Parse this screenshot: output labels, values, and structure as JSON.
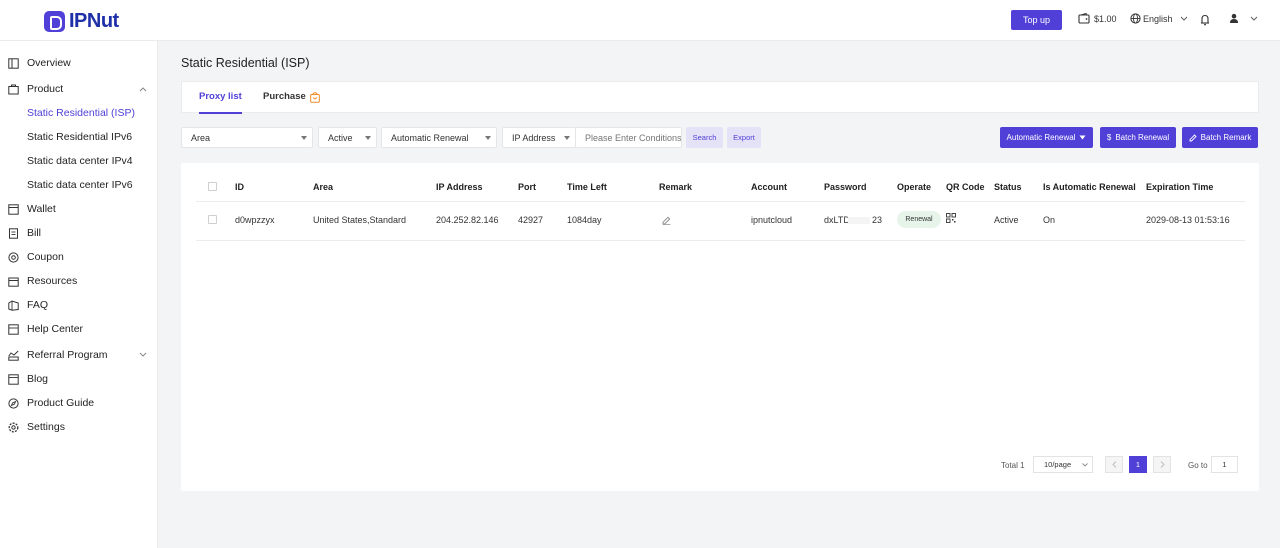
{
  "header": {
    "logo_text": "IPNut",
    "topup_label": "Top up",
    "balance": "$1.00",
    "language": "English"
  },
  "sidebar": {
    "overview": "Overview",
    "product": "Product",
    "product_sub": [
      "Static Residential (ISP)",
      "Static Residential IPv6",
      "Static data center IPv4",
      "Static data center IPv6"
    ],
    "wallet": "Wallet",
    "bill": "Bill",
    "coupon": "Coupon",
    "resources": "Resources",
    "faq": "FAQ",
    "help_center": "Help Center",
    "referral": "Referral Program",
    "blog": "Blog",
    "product_guide": "Product Guide",
    "settings": "Settings"
  },
  "page": {
    "title": "Static Residential (ISP)",
    "tabs": [
      "Proxy list",
      "Purchase"
    ]
  },
  "filters": {
    "area": "Area",
    "status": "Active",
    "renewal": "Automatic Renewal",
    "ip_select": "IP Address",
    "conditions_placeholder": "Please Enter Conditions",
    "search_label": "Search",
    "export_label": "Export"
  },
  "actions": {
    "auto_renewal": "Automatic Renewal",
    "batch_renewal": "Batch Renewal",
    "batch_remark": "Batch Remark"
  },
  "table": {
    "headers": [
      "ID",
      "Area",
      "IP Address",
      "Port",
      "Time Left",
      "Remark",
      "Account",
      "Password",
      "Operate",
      "QR Code",
      "Status",
      "Is Automatic Renewal",
      "Expiration Time"
    ],
    "rows": [
      {
        "id": "d0wpzzyx",
        "area": "United States,Standard",
        "ip": "204.252.82.146",
        "port": "42927",
        "time_left": "1084day",
        "account": "ipnutcloud",
        "password_start": "dxLTD",
        "password_end": "23",
        "operate": "Renewal",
        "status": "Active",
        "auto_renewal": "On",
        "expiration": "2029-08-13 01:53:16"
      }
    ]
  },
  "pagination": {
    "total": "Total 1",
    "page_size": "10/page",
    "current_page": "1",
    "goto_label": "Go to",
    "goto_value": "1"
  },
  "colors": {
    "accent": "#5140d8",
    "background": "#f3f4f6"
  }
}
